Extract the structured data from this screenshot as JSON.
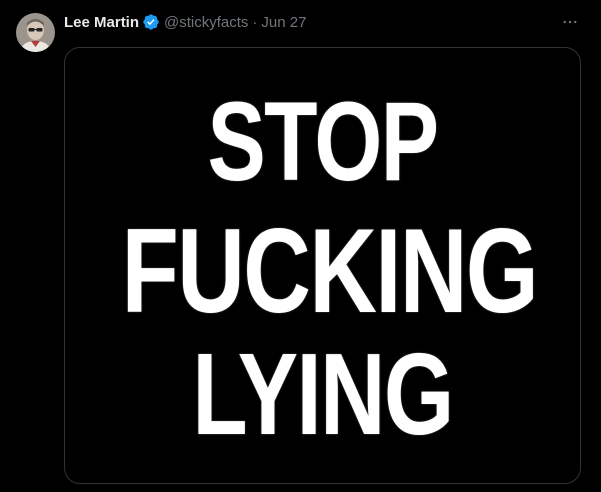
{
  "tweet": {
    "author": {
      "display_name": "Lee Martin",
      "handle": "@stickyfacts",
      "verified": true,
      "avatar": "avatar"
    },
    "separator": "·",
    "date": "Jun 27",
    "more_icon": "more-horizontal-icon",
    "media": {
      "lines": [
        "STOP",
        "FUCKING",
        "LYING"
      ]
    }
  },
  "colors": {
    "background": "#000000",
    "name": "#e7e9ea",
    "secondary_text": "#71767b",
    "verified_badge": "#1d9bf0",
    "media_border": "#2f3336",
    "media_text": "#ffffff"
  }
}
